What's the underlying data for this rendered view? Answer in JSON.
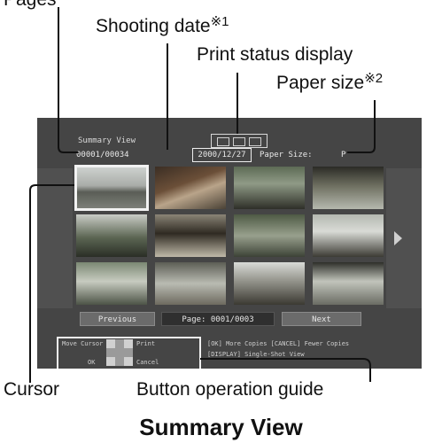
{
  "callouts": {
    "pages": "Pages",
    "shooting_date": "Shooting date",
    "shooting_date_note": "※1",
    "print_status": "Print status display",
    "paper_size": "Paper size",
    "paper_size_note": "※2",
    "cursor": "Cursor",
    "button_guide": "Button operation guide"
  },
  "screen": {
    "title": "Summary View",
    "counter": "00001/00034",
    "date": "2000/12/27",
    "paper_label": "Paper Size:",
    "paper_value": "P",
    "nav": {
      "previous": "Previous",
      "page": "Page: 0001/0003",
      "next": "Next"
    },
    "guide": {
      "move_cursor": "Move Cursor",
      "print": "Print",
      "ok": "OK",
      "cancel": "Cancel",
      "copies": "[OK] More Copies  [CANCEL] Fewer Copies",
      "display": "[DISPLAY] Single-Shot View"
    }
  },
  "caption": "Summary View"
}
